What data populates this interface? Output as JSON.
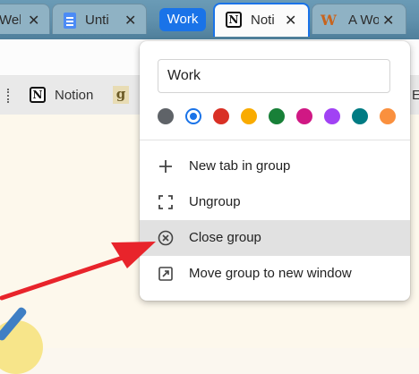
{
  "tabs": [
    {
      "title": "Welc",
      "close": "✕"
    },
    {
      "title": "Unti",
      "close": "✕"
    },
    {
      "title": "Noti",
      "close": "✕"
    },
    {
      "title": "A Wo",
      "close": "✕"
    }
  ],
  "group_chip": {
    "label": "Work",
    "color": "#1a73e8"
  },
  "bookmarks": {
    "items": [
      {
        "label": "Notion"
      },
      {
        "label": "g"
      }
    ],
    "overflow": "E"
  },
  "group_menu": {
    "name_value": "Work",
    "colors": [
      {
        "name": "grey",
        "hex": "#5f6368",
        "selected": false
      },
      {
        "name": "blue",
        "hex": "#1a73e8",
        "selected": true
      },
      {
        "name": "red",
        "hex": "#d93025",
        "selected": false
      },
      {
        "name": "yellow",
        "hex": "#f9ab00",
        "selected": false
      },
      {
        "name": "green",
        "hex": "#188038",
        "selected": false
      },
      {
        "name": "pink",
        "hex": "#d01884",
        "selected": false
      },
      {
        "name": "purple",
        "hex": "#a142f4",
        "selected": false
      },
      {
        "name": "cyan",
        "hex": "#007b83",
        "selected": false
      },
      {
        "name": "orange",
        "hex": "#fa903e",
        "selected": false
      }
    ],
    "items": [
      {
        "label": "New tab in group",
        "icon": "plus-icon"
      },
      {
        "label": "Ungroup",
        "icon": "ungroup-icon"
      },
      {
        "label": "Close group",
        "icon": "close-circle-icon",
        "hovered": true
      },
      {
        "label": "Move group to new window",
        "icon": "move-window-icon"
      }
    ]
  },
  "annotation": {
    "arrow_color": "#e8242b"
  }
}
